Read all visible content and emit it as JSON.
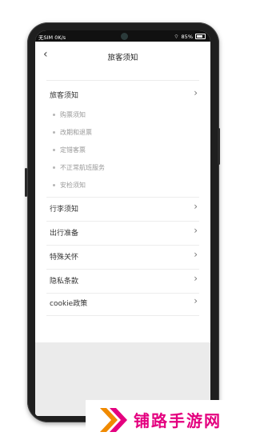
{
  "status_bar": {
    "carrier": "无SIM 0K/s",
    "battery": "85%"
  },
  "header": {
    "title": "旅客须知"
  },
  "section": {
    "title": "旅客须知",
    "items": [
      "购票须知",
      "改期和退票",
      "定错客票",
      "不正常航班服务",
      "安检须知"
    ]
  },
  "menu": [
    {
      "label": "行李须知"
    },
    {
      "label": "出行准备"
    },
    {
      "label": "特殊关怀"
    },
    {
      "label": "隐私条款"
    },
    {
      "label": "cookie政策"
    }
  ],
  "icons": {
    "back": "chevron-left-icon",
    "chevron": "chevron-right-icon",
    "dot": "bullet-icon"
  },
  "watermark": {
    "text": "铺路手游网"
  },
  "colors": {
    "brand": "#e4007f",
    "watermark_orange": "#f08a00"
  }
}
